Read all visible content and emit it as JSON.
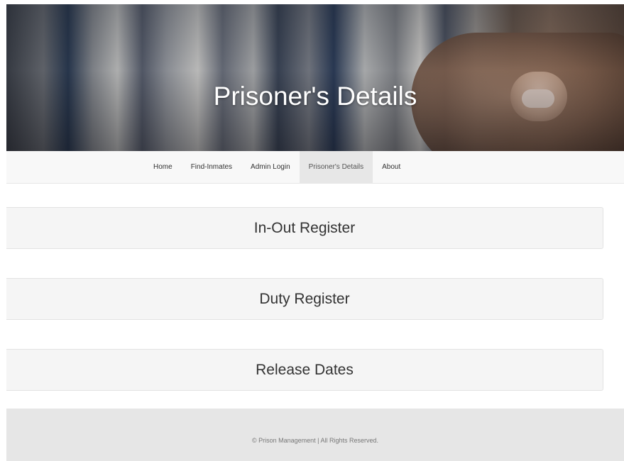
{
  "hero": {
    "title": "Prisoner's Details"
  },
  "navbar": {
    "items": [
      {
        "label": "Home",
        "active": false
      },
      {
        "label": "Find-Inmates",
        "active": false
      },
      {
        "label": "Admin Login",
        "active": false
      },
      {
        "label": "Prisoner's Details",
        "active": true
      },
      {
        "label": "About",
        "active": false
      }
    ]
  },
  "registers": [
    {
      "label": "In-Out Register"
    },
    {
      "label": "Duty Register"
    },
    {
      "label": "Release Dates"
    }
  ],
  "footer": {
    "copyright": "© Prison Management | All Rights Reserved."
  },
  "colors": {
    "navbar_bg": "#f8f8f8",
    "nav_active_bg": "#e7e7e7",
    "panel_bg": "#f5f5f5",
    "footer_bg": "#e6e6e6",
    "hero_title": "#ffffff"
  }
}
